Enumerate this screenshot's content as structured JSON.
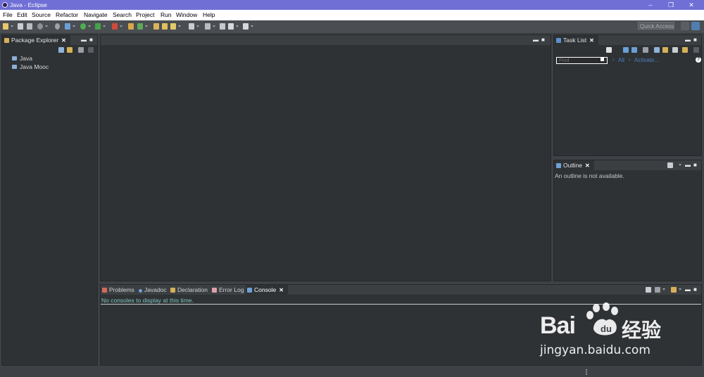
{
  "window": {
    "title": "Java - Eclipse",
    "icon": "eclipse-icon",
    "controls": [
      "–",
      "❐",
      "✕"
    ]
  },
  "menubar": {
    "items": [
      "File",
      "Edit",
      "Source",
      "Refactor",
      "Navigate",
      "Search",
      "Project",
      "Run",
      "Window",
      "Help"
    ]
  },
  "toolbar": {
    "quick_access_placeholder": "Quick Access"
  },
  "package_explorer": {
    "title": "Package Explorer",
    "close_glyph": "✕",
    "projects": [
      "Java",
      "Java Mooc"
    ]
  },
  "editor": {
    "minimize_glyph": "▬",
    "maximize_glyph": "■"
  },
  "task_list": {
    "title": "Task List",
    "close_glyph": "✕",
    "find_placeholder": "Find",
    "filter_all": "All",
    "filter_activate": "Activate...",
    "help_glyph": "?"
  },
  "outline": {
    "title": "Outline",
    "close_glyph": "✕",
    "message": "An outline is not available."
  },
  "bottom_panel": {
    "tabs": [
      "Problems",
      "Javadoc",
      "Declaration",
      "Error Log",
      "Console"
    ],
    "active_tab": "Console",
    "close_glyph": "✕",
    "console_message": "No consoles to display at this time."
  },
  "watermark": {
    "brand_left": "Bai",
    "brand_right": "经验",
    "url": "jingyan.baidu.com"
  },
  "colors": {
    "title_bar": "#6f6fd6",
    "workbench_bg": "#3e4145",
    "view_bg": "#2f3234",
    "link": "#4a7fc1",
    "console_text": "#7ec3c0"
  }
}
